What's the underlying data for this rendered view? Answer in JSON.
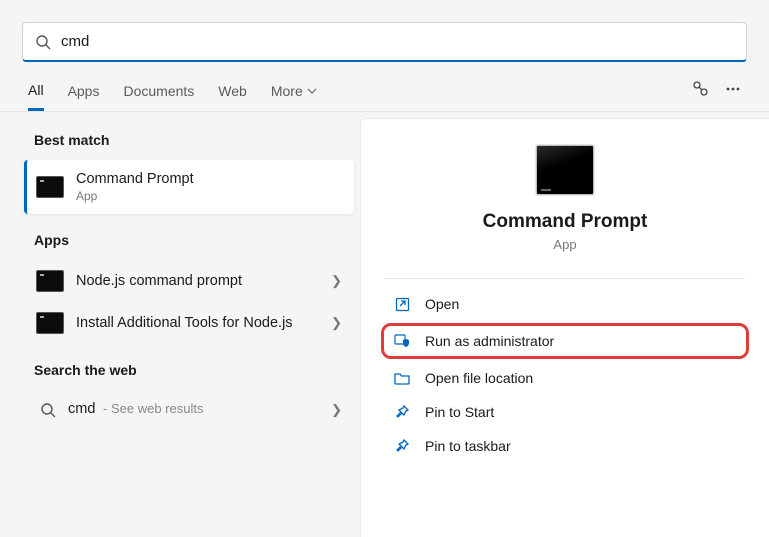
{
  "search": {
    "value": "cmd"
  },
  "tabs": {
    "items": [
      "All",
      "Apps",
      "Documents",
      "Web",
      "More"
    ],
    "active": 0
  },
  "left": {
    "best_label": "Best match",
    "best": {
      "title": "Command Prompt",
      "sub": "App"
    },
    "apps_label": "Apps",
    "apps": [
      {
        "title": "Node.js command prompt"
      },
      {
        "title": "Install Additional Tools for Node.js"
      }
    ],
    "web_label": "Search the web",
    "web": {
      "term": "cmd",
      "suffix": " - See web results"
    }
  },
  "preview": {
    "title": "Command Prompt",
    "sub": "App",
    "actions": [
      {
        "key": "open",
        "label": "Open"
      },
      {
        "key": "run-admin",
        "label": "Run as administrator",
        "highlight": true
      },
      {
        "key": "open-location",
        "label": "Open file location"
      },
      {
        "key": "pin-start",
        "label": "Pin to Start"
      },
      {
        "key": "pin-taskbar",
        "label": "Pin to taskbar"
      }
    ]
  }
}
